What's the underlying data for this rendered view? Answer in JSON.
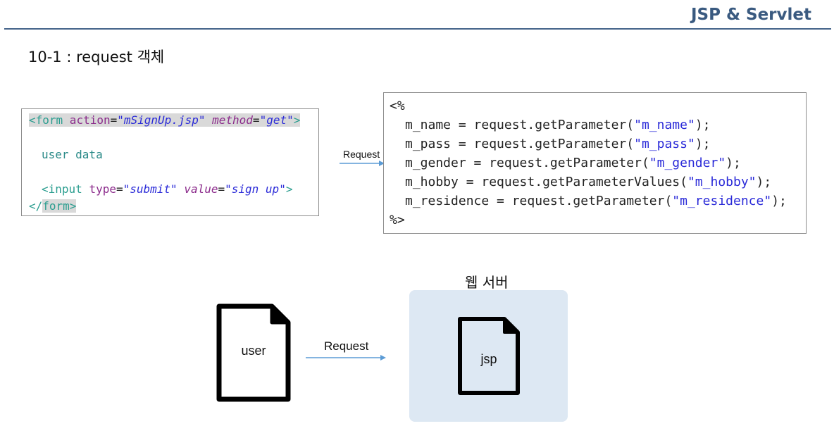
{
  "header": {
    "title": "JSP & Servlet"
  },
  "section": {
    "title": "10-1 : request 객체"
  },
  "form_code": {
    "line1": {
      "open": "<",
      "tag": "form",
      "attr1": " action",
      "eq1": "=",
      "val1": "\"mSignUp.jsp\"",
      "attr2": " method",
      "eq2": "=",
      "val2": "\"get\"",
      "close": ">"
    },
    "line2": "user data",
    "line3": {
      "open": "<",
      "tag": "input",
      "attr1": " type",
      "eq1": "=",
      "val1": "\"submit\"",
      "attr2": " value",
      "eq2": "=",
      "val2": "\"sign up\"",
      "close": ">"
    },
    "line4": {
      "open": "</",
      "tag": "form",
      "close": ">"
    }
  },
  "jsp_code": {
    "open": "<%",
    "close": "%>",
    "lines": [
      {
        "pre": "m_name = request.getParameter(",
        "arg": "\"m_name\"",
        "post": ");"
      },
      {
        "pre": "m_pass = request.getParameter(",
        "arg": "\"m_pass\"",
        "post": ");"
      },
      {
        "pre": "m_gender = request.getParameter(",
        "arg": "\"m_gender\"",
        "post": ");"
      },
      {
        "pre": "m_hobby = request.getParameterValues(",
        "arg": "\"m_hobby\"",
        "post": ");"
      },
      {
        "pre": "m_residence = request.getParameter(",
        "arg": "\"m_residence\"",
        "post": ");"
      }
    ]
  },
  "top_arrow": {
    "label": "Request",
    "color": "#5b9bd5"
  },
  "diagram": {
    "server_label": "웹 서버",
    "user_doc": "user",
    "jsp_doc": "jsp",
    "arrow_label": "Request",
    "server_bg_color": "#dde8f3"
  }
}
